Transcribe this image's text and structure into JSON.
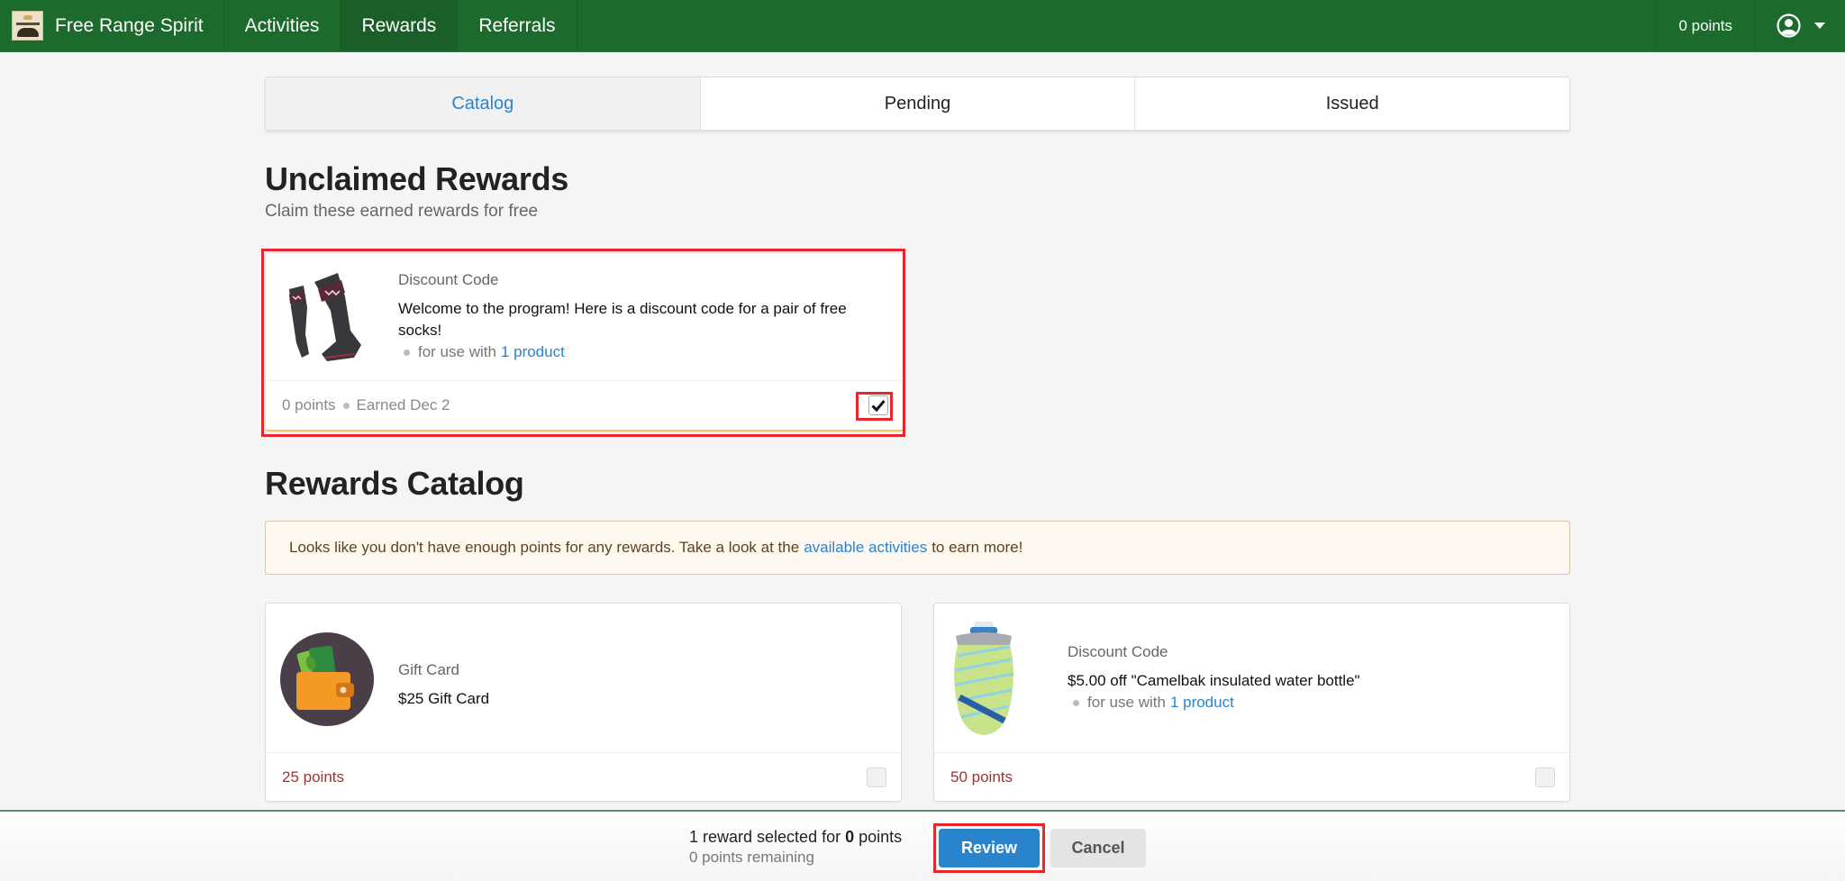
{
  "nav": {
    "brand": "Free Range Spirit",
    "items": [
      {
        "label": "Activities",
        "active": false
      },
      {
        "label": "Rewards",
        "active": true
      },
      {
        "label": "Referrals",
        "active": false
      }
    ],
    "points": "0 points",
    "user_icon": "user-circle-icon"
  },
  "tabs": [
    {
      "label": "Catalog",
      "active": true
    },
    {
      "label": "Pending",
      "active": false
    },
    {
      "label": "Issued",
      "active": false
    }
  ],
  "unclaimed": {
    "title": "Unclaimed Rewards",
    "subtitle": "Claim these earned rewards for free",
    "cards": [
      {
        "type": "Discount Code",
        "title": "Welcome to the program! Here is a discount code for a pair of free socks!",
        "meta_prefix": "for use with",
        "meta_link": "1 product",
        "points": "0 points",
        "earned": "Earned Dec 2",
        "checked": true,
        "image": "socks-image"
      }
    ]
  },
  "catalog": {
    "title": "Rewards Catalog",
    "alert": {
      "before": "Looks like you don't have enough points for any rewards. Take a look at the",
      "link": "available activities",
      "after": "to earn more!"
    },
    "cards": [
      {
        "type": "Gift Card",
        "title": "$25 Gift Card",
        "points": "25 points",
        "checked": false,
        "image": "wallet-image"
      },
      {
        "type": "Discount Code",
        "title": "$5.00 off \"Camelbak insulated water bottle\"",
        "meta_prefix": "for use with",
        "meta_link": "1 product",
        "points": "50 points",
        "checked": false,
        "image": "water-bottle-image"
      }
    ]
  },
  "bottom_bar": {
    "count_text": "1 reward selected for",
    "points_value": "0",
    "points_suffix": "points",
    "remaining": "0 points remaining",
    "review_label": "Review",
    "cancel_label": "Cancel"
  },
  "colors": {
    "nav_green": "#1c6b2c",
    "accent_blue": "#2a84cc",
    "points_red": "#a2332f",
    "highlight_red": "#e8262b"
  }
}
